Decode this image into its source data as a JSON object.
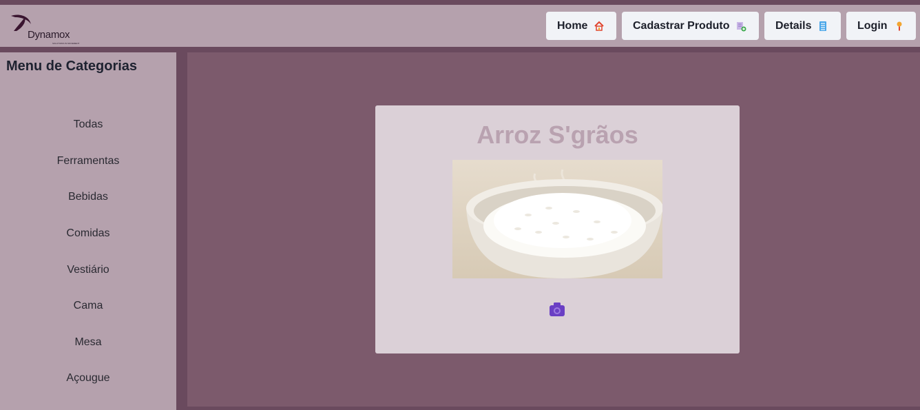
{
  "header": {
    "logo_text": "Dynamox",
    "logo_tagline": "SOLUTIONS IN MOVEMENT",
    "nav": [
      {
        "label": "Home",
        "icon": "house-icon"
      },
      {
        "label": "Cadastrar Produto",
        "icon": "add-document-icon"
      },
      {
        "label": "Details",
        "icon": "list-document-icon"
      },
      {
        "label": "Login",
        "icon": "person-icon"
      }
    ]
  },
  "sidebar": {
    "title": "Menu de Categorias",
    "categories": [
      "Todas",
      "Ferramentas",
      "Bebidas",
      "Comidas",
      "Vestiário",
      "Cama",
      "Mesa",
      "Açougue"
    ]
  },
  "product": {
    "name": "Arroz S'grãos",
    "image": "rice-bowl-photo",
    "action_icon": "camera-icon"
  },
  "colors": {
    "page_bg": "#6a4a5e",
    "header_bg": "#b5a1ad",
    "main_bg": "#7c5a6c",
    "card_bg": "#dbd0d7",
    "title_color": "#b9a2b0",
    "camera_color": "#6a3fc4"
  }
}
